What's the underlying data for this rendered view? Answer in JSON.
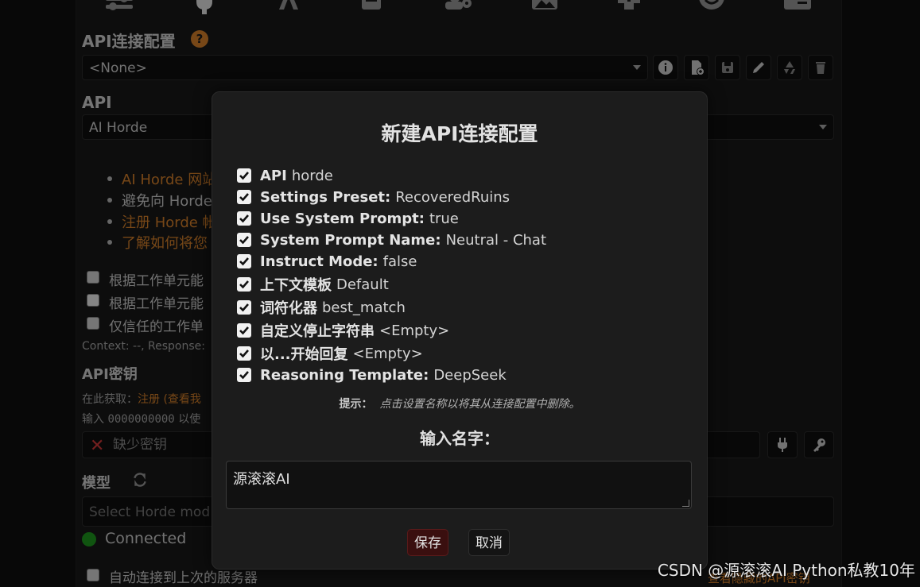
{
  "background": {
    "connection_profile_heading": "API连接配置",
    "help_mark": "?",
    "profile_value": "<None>",
    "api_heading": "API",
    "api_value": "AI Horde",
    "links": [
      "AI Horde 网站",
      "避免向 Horde",
      "注册 Horde 帐",
      "了解如何将您"
    ],
    "checkboxes": [
      "根据工作单元能",
      "根据工作单元能",
      "仅信任的工作单"
    ],
    "context_text": "Context: --, Response:",
    "api_key_heading": "API密钥",
    "get_here_prefix": "在此获取：",
    "get_here_link": "注册 (查看我",
    "enter_text_prefix": "输入",
    "enter_code": "0000000000",
    "enter_text_suffix": "以使",
    "missing_key": "缺少密钥",
    "model_heading": "模型",
    "model_placeholder": "Select Horde mod",
    "status": "Connected",
    "auto_connect": "自动连接到上次的服务器",
    "view_hidden_keys": "查看隐藏的API密钥"
  },
  "dialog": {
    "title": "新建API连接配置",
    "items": [
      {
        "label": "API",
        "value": "horde",
        "checked": true
      },
      {
        "label": "Settings Preset:",
        "value": "RecoveredRuins",
        "checked": true
      },
      {
        "label": "Use System Prompt:",
        "value": "true",
        "checked": true
      },
      {
        "label": "System Prompt Name:",
        "value": "Neutral - Chat",
        "checked": true
      },
      {
        "label": "Instruct Mode:",
        "value": "false",
        "checked": true
      },
      {
        "label": "上下文模板",
        "value": "Default",
        "checked": true
      },
      {
        "label": "词符化器",
        "value": "best_match",
        "checked": true
      },
      {
        "label": "自定义停止字符串",
        "value": "<Empty>",
        "checked": true
      },
      {
        "label": "以...开始回复",
        "value": "<Empty>",
        "checked": true
      },
      {
        "label": "Reasoning Template:",
        "value": "DeepSeek",
        "checked": true
      }
    ],
    "hint_label": "提示：",
    "hint_text": "点击设置名称以将其从连接配置中删除。",
    "name_label": "输入名字：",
    "name_value": "源滚滚AI",
    "save_label": "保存",
    "cancel_label": "取消"
  },
  "watermark": "CSDN @源滚滚AI Python私教10年",
  "colors": {
    "accent": "#d9822b",
    "status": "#1e9a1e",
    "save_button": "#3a0f0f"
  }
}
